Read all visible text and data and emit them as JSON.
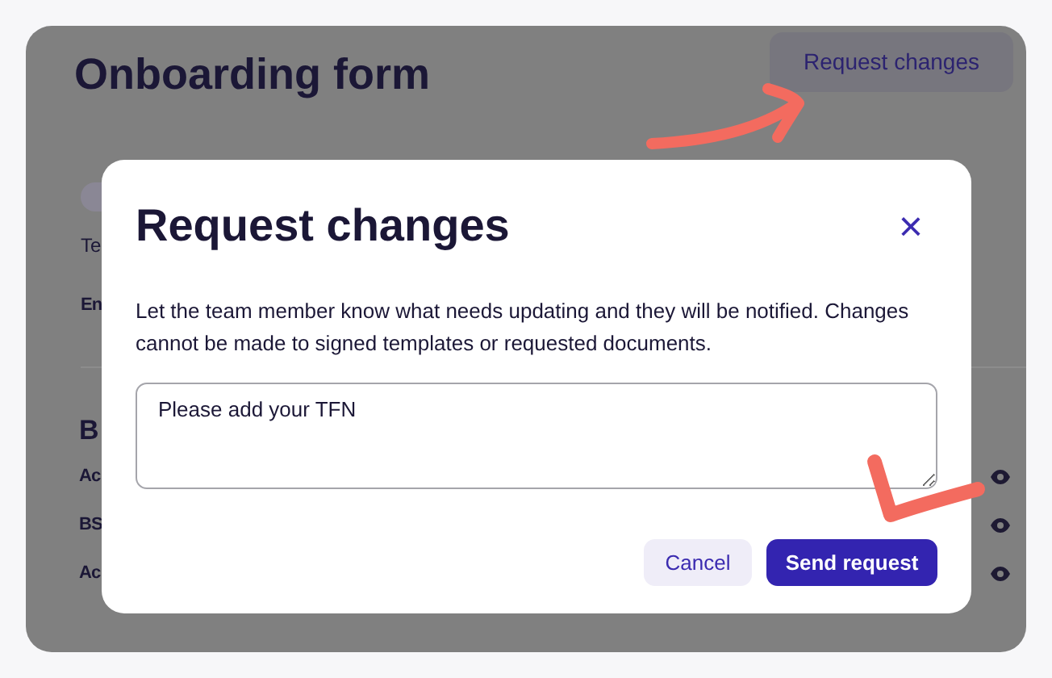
{
  "page": {
    "title": "Onboarding form",
    "action_button": "Request changes",
    "background_fragments": {
      "line_1": "Te",
      "line_2": "En",
      "section_heading": "B",
      "rows": [
        "Ac",
        "BS",
        "Ac"
      ]
    }
  },
  "dialog": {
    "title": "Request changes",
    "close": "×",
    "message": "Let the team member know what needs updating and they will be notified. Changes cannot be made to signed templates or requested documents.",
    "textarea_value": "Please add your TFN",
    "buttons": [
      {
        "label": "Cancel",
        "kind": "secondary"
      },
      {
        "label": "Send request",
        "kind": "primary"
      }
    ]
  }
}
